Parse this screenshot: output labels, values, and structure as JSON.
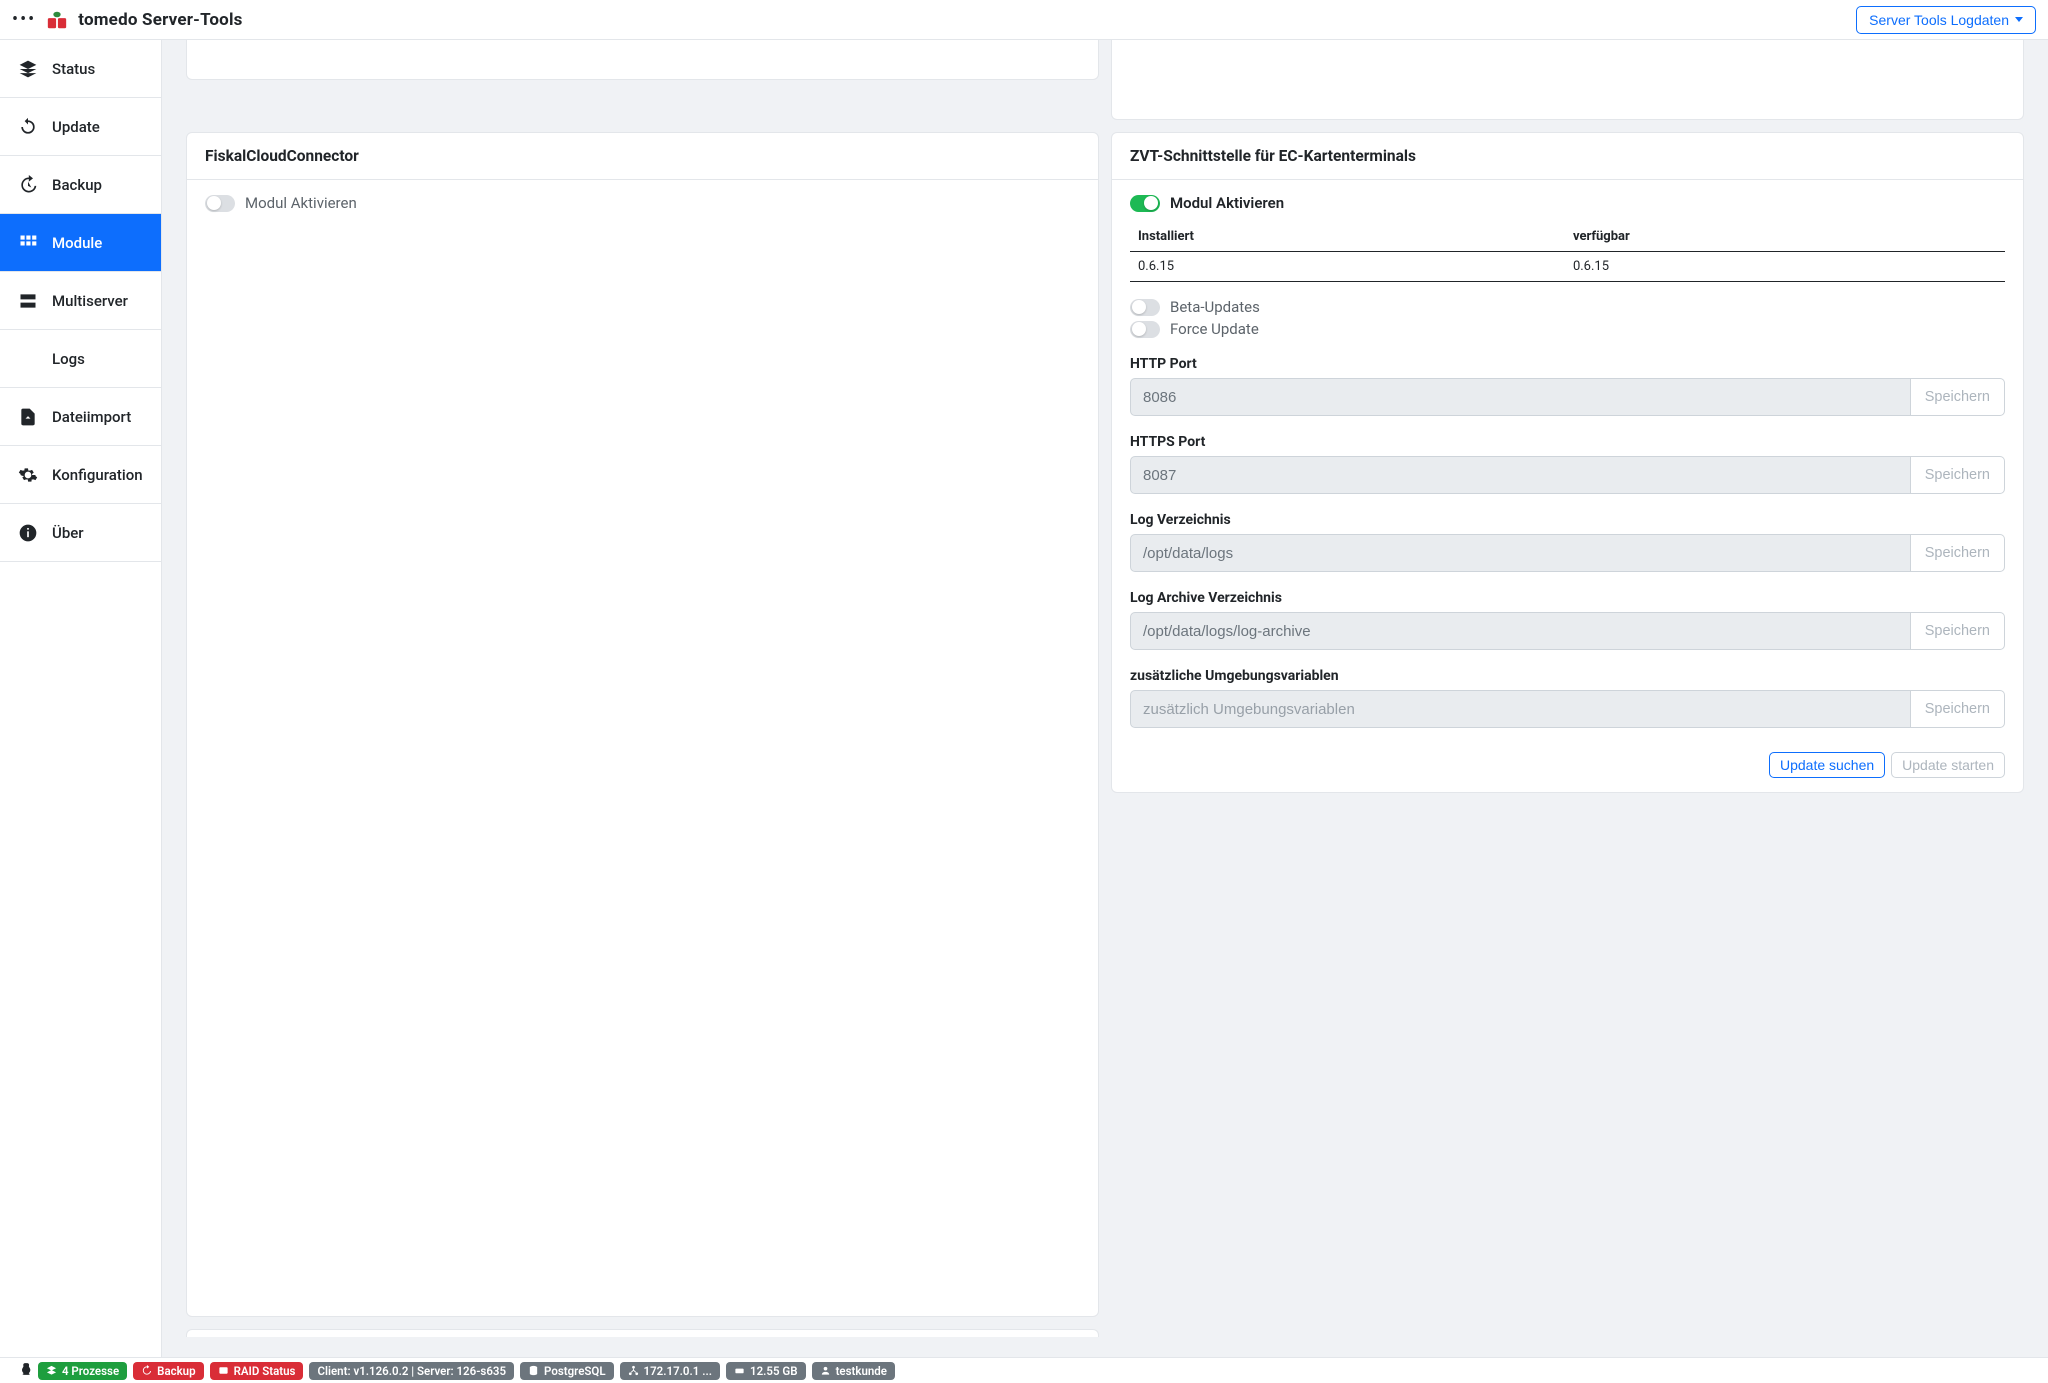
{
  "topbar": {
    "brand": "tomedo Server-Tools",
    "log_button": "Server Tools Logdaten"
  },
  "sidebar": {
    "items": [
      {
        "label": "Status",
        "icon": "layers"
      },
      {
        "label": "Update",
        "icon": "sync"
      },
      {
        "label": "Backup",
        "icon": "history"
      },
      {
        "label": "Module",
        "icon": "grid",
        "active": true
      },
      {
        "label": "Multiserver",
        "icon": "server"
      },
      {
        "label": "Logs",
        "icon": "list"
      },
      {
        "label": "Dateiimport",
        "icon": "file-arrow"
      },
      {
        "label": "Konfiguration",
        "icon": "gear"
      },
      {
        "label": "Über",
        "icon": "info"
      }
    ]
  },
  "cards": {
    "fiskal": {
      "title": "FiskalCloudConnector",
      "activate_label": "Modul Aktivieren",
      "activate_on": false
    },
    "zvt": {
      "title": "ZVT-Schnittstelle für EC-Kartenterminals",
      "activate_label": "Modul Aktivieren",
      "activate_on": true,
      "version_table": {
        "headers": [
          "Installiert",
          "verfügbar"
        ],
        "row": [
          "0.6.15",
          "0.6.15"
        ]
      },
      "toggles": [
        {
          "label": "Beta-Updates",
          "on": false
        },
        {
          "label": "Force Update",
          "on": false
        }
      ],
      "fields": [
        {
          "label": "HTTP Port",
          "value": "8086",
          "placeholder": "",
          "save": "Speichern"
        },
        {
          "label": "HTTPS Port",
          "value": "8087",
          "placeholder": "",
          "save": "Speichern"
        },
        {
          "label": "Log Verzeichnis",
          "value": "/opt/data/logs",
          "placeholder": "",
          "save": "Speichern"
        },
        {
          "label": "Log Archive Verzeichnis",
          "value": "/opt/data/logs/log-archive",
          "placeholder": "",
          "save": "Speichern"
        },
        {
          "label": "zusätzliche Umgebungsvariablen",
          "value": "",
          "placeholder": "zusätzlich Umgebungsvariablen",
          "save": "Speichern"
        }
      ],
      "footer": {
        "search_update": "Update suchen",
        "start_update": "Update starten"
      }
    }
  },
  "statusbar": {
    "processes": "4 Prozesse",
    "backup": "Backup",
    "raid": "RAID Status",
    "client": "Client: v1.126.0.2 | Server: 126-s635",
    "db": "PostgreSQL",
    "ip": "172.17.0.1 ...",
    "disk": "12.55 GB",
    "user": "testkunde"
  }
}
